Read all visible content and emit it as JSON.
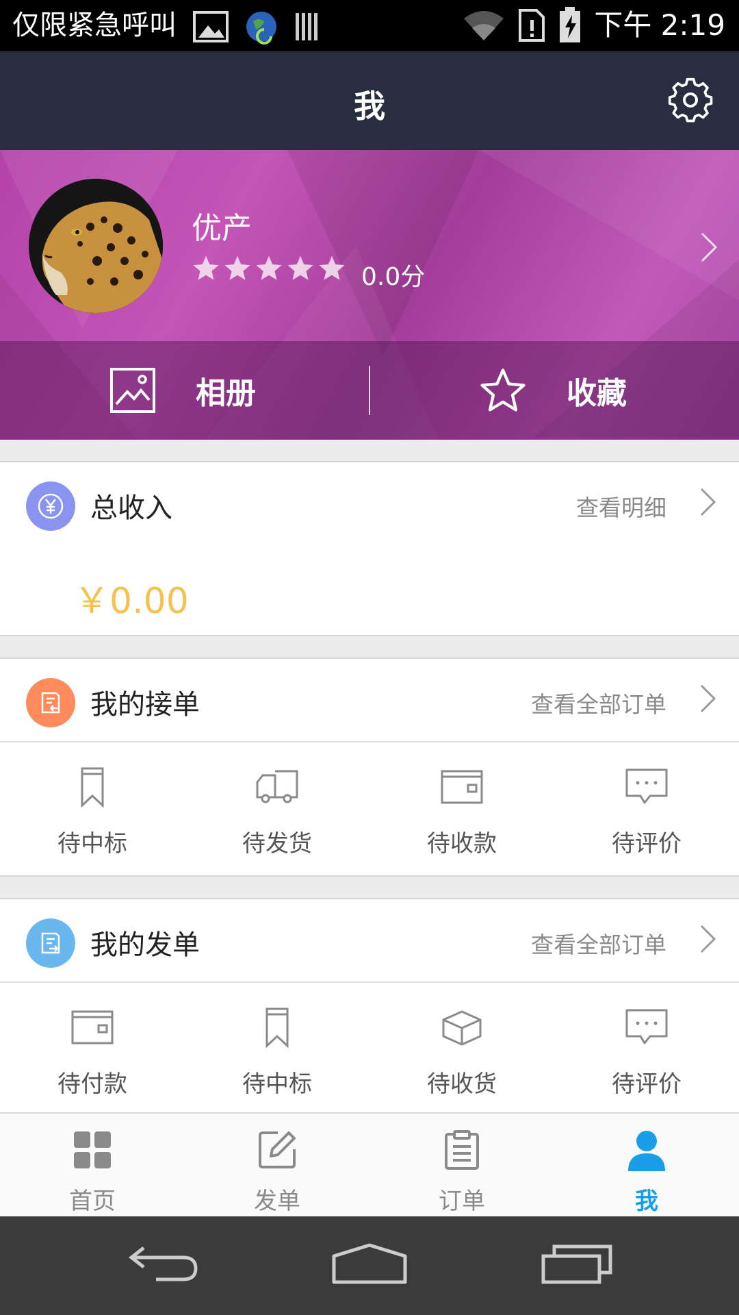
{
  "status_bar": {
    "carrier": "仅限紧急呼叫",
    "time": "下午 2:19"
  },
  "header": {
    "title": "我"
  },
  "profile": {
    "name": "优产",
    "rating_stars": 0,
    "rating_max": 5,
    "score": "0.0分",
    "tabs": [
      {
        "label": "相册",
        "icon": "image-icon"
      },
      {
        "label": "收藏",
        "icon": "star-icon"
      }
    ]
  },
  "income": {
    "title": "总收入",
    "link": "查看明细",
    "amount": "￥0.00",
    "icon": "yen-icon"
  },
  "received_orders": {
    "title": "我的接单",
    "link": "查看全部订单",
    "icon": "order-receive-icon",
    "items": [
      {
        "label": "待中标",
        "icon": "bookmark-icon"
      },
      {
        "label": "待发货",
        "icon": "truck-icon"
      },
      {
        "label": "待收款",
        "icon": "wallet-icon"
      },
      {
        "label": "待评价",
        "icon": "comment-icon"
      }
    ]
  },
  "sent_orders": {
    "title": "我的发单",
    "link": "查看全部订单",
    "icon": "order-send-icon",
    "items": [
      {
        "label": "待付款",
        "icon": "wallet-icon"
      },
      {
        "label": "待中标",
        "icon": "bookmark-icon"
      },
      {
        "label": "待收货",
        "icon": "package-icon"
      },
      {
        "label": "待评价",
        "icon": "comment-icon"
      }
    ]
  },
  "bottom_nav": [
    {
      "label": "首页",
      "icon": "grid-icon",
      "active": false
    },
    {
      "label": "发单",
      "icon": "edit-icon",
      "active": false
    },
    {
      "label": "订单",
      "icon": "clipboard-icon",
      "active": false
    },
    {
      "label": "我",
      "icon": "person-icon",
      "active": true
    }
  ],
  "colors": {
    "title_bar": "#282d3f",
    "profile_bg": "#b443a9",
    "amount": "#f5c24d",
    "income_icon": "#8a93f0",
    "received_icon": "#ff8a5c",
    "sent_icon": "#6ab6ef",
    "active_nav": "#1a9ee8"
  }
}
